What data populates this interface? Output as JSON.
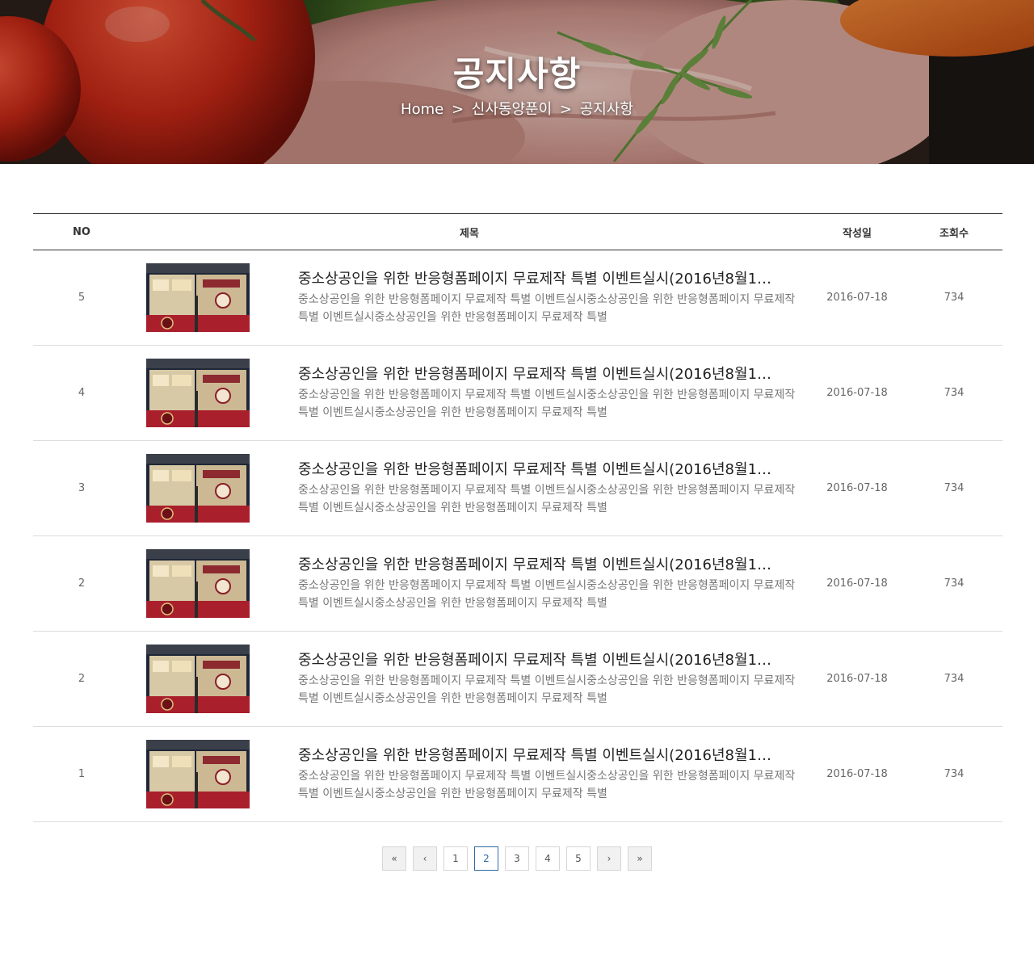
{
  "hero": {
    "title": "공지사항",
    "breadcrumb": [
      "Home",
      "신사동양푼이",
      "공지사항"
    ],
    "separator": ">"
  },
  "board": {
    "columns": {
      "no": "NO",
      "title": "제목",
      "date": "작성일",
      "views": "조회수"
    },
    "rows": [
      {
        "no": "5",
        "title": "중소상공인을 위한 반응형폼페이지 무료제작 특별 이벤트실시(2016년8월1…",
        "excerpt": "중소상공인을 위한 반응형폼페이지 무료제작 특별 이벤트실시중소상공인을 위한 반응형폼페이지 무료제작 특별 이벤트실시중소상공인을 위한 반응형폼페이지 무료제작 특별",
        "date": "2016-07-18",
        "views": "734"
      },
      {
        "no": "4",
        "title": "중소상공인을 위한 반응형폼페이지 무료제작 특별 이벤트실시(2016년8월1…",
        "excerpt": "중소상공인을 위한 반응형폼페이지 무료제작 특별 이벤트실시중소상공인을 위한 반응형폼페이지 무료제작 특별 이벤트실시중소상공인을 위한 반응형폼페이지 무료제작 특별",
        "date": "2016-07-18",
        "views": "734"
      },
      {
        "no": "3",
        "title": "중소상공인을 위한 반응형폼페이지 무료제작 특별 이벤트실시(2016년8월1…",
        "excerpt": "중소상공인을 위한 반응형폼페이지 무료제작 특별 이벤트실시중소상공인을 위한 반응형폼페이지 무료제작 특별 이벤트실시중소상공인을 위한 반응형폼페이지 무료제작 특별",
        "date": "2016-07-18",
        "views": "734"
      },
      {
        "no": "2",
        "title": "중소상공인을 위한 반응형폼페이지 무료제작 특별 이벤트실시(2016년8월1…",
        "excerpt": "중소상공인을 위한 반응형폼페이지 무료제작 특별 이벤트실시중소상공인을 위한 반응형폼페이지 무료제작 특별 이벤트실시중소상공인을 위한 반응형폼페이지 무료제작 특별",
        "date": "2016-07-18",
        "views": "734"
      },
      {
        "no": "2",
        "title": "중소상공인을 위한 반응형폼페이지 무료제작 특별 이벤트실시(2016년8월1…",
        "excerpt": "중소상공인을 위한 반응형폼페이지 무료제작 특별 이벤트실시중소상공인을 위한 반응형폼페이지 무료제작 특별 이벤트실시중소상공인을 위한 반응형폼페이지 무료제작 특별",
        "date": "2016-07-18",
        "views": "734"
      },
      {
        "no": "1",
        "title": "중소상공인을 위한 반응형폼페이지 무료제작 특별 이벤트실시(2016년8월1…",
        "excerpt": "중소상공인을 위한 반응형폼페이지 무료제작 특별 이벤트실시중소상공인을 위한 반응형폼페이지 무료제작 특별 이벤트실시중소상공인을 위한 반응형폼페이지 무료제작 특별",
        "date": "2016-07-18",
        "views": "734"
      }
    ]
  },
  "pagination": {
    "first": "«",
    "prev": "‹",
    "pages": [
      "1",
      "2",
      "3",
      "4",
      "5"
    ],
    "current": "2",
    "next": "›",
    "last": "»"
  },
  "colors": {
    "accent": "#2d6aa3",
    "row_divider": "#dcdcdc",
    "header_border": "#333333"
  }
}
